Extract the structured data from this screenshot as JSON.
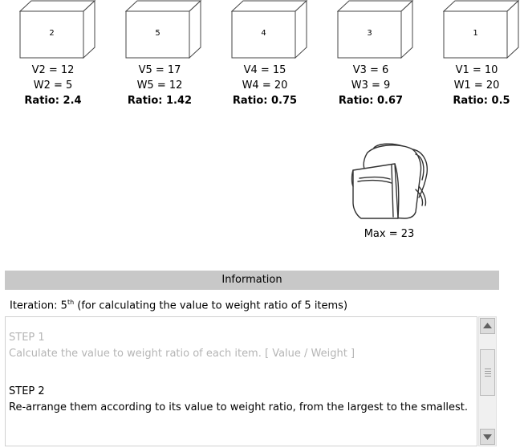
{
  "items": [
    {
      "box_label": "2",
      "value_text": "V2 = 12",
      "weight_text": "W2 = 5",
      "ratio_text": "Ratio: 2.4"
    },
    {
      "box_label": "5",
      "value_text": "V5 = 17",
      "weight_text": "W5 = 12",
      "ratio_text": "Ratio: 1.42"
    },
    {
      "box_label": "4",
      "value_text": "V4 = 15",
      "weight_text": "W4 = 20",
      "ratio_text": "Ratio: 0.75"
    },
    {
      "box_label": "3",
      "value_text": "V3 = 6",
      "weight_text": "W3 = 9",
      "ratio_text": "Ratio: 0.67"
    },
    {
      "box_label": "1",
      "value_text": "V1 = 10",
      "weight_text": "W1 = 20",
      "ratio_text": "Ratio: 0.5"
    }
  ],
  "knapsack": {
    "icon": "backpack-icon",
    "max_text": "Max = 23"
  },
  "info": {
    "header": "Information",
    "iteration_prefix": "Iteration: 5",
    "iteration_sup": "th",
    "iteration_suffix": " (for calculating the value to weight ratio of 5 items)",
    "step1_title": "STEP 1",
    "step1_text": "Calculate the value to weight ratio of each item. [ Value / Weight ]",
    "step2_title": "STEP 2",
    "step2_text": "Re-arrange them according to its value to weight ratio, from the largest to the smallest."
  },
  "colors": {
    "header_bg": "#c8c8c8",
    "faded_text": "#b5b5b5"
  }
}
